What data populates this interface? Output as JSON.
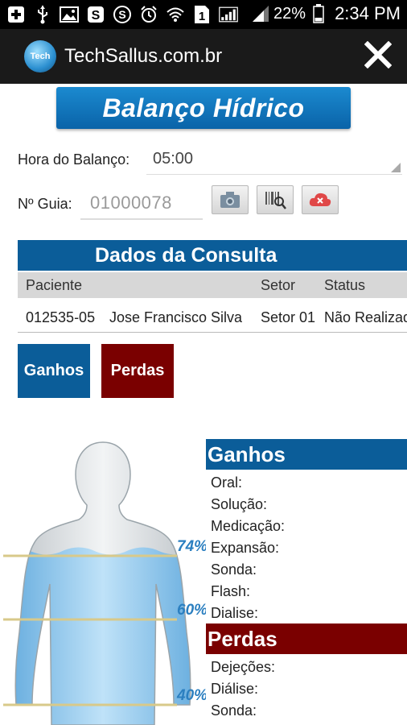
{
  "statusbar": {
    "battery_text": "22%",
    "time": "2:34 PM",
    "left_icons": [
      "add-icon",
      "usb-icon",
      "image-icon",
      "app-s-icon",
      "skype-icon",
      "alarm-icon",
      "wifi-icon",
      "sim-1-icon",
      "signal-icon"
    ]
  },
  "actionbar": {
    "logo_text": "Tech",
    "title": "TechSallus.com.br"
  },
  "banner": {
    "title": "Balanço Hídrico"
  },
  "form": {
    "hora_label": "Hora do Balanço:",
    "hora_value": "05:00",
    "guia_label": "Nº Guia:",
    "guia_value": "01000078"
  },
  "consulta": {
    "title": "Dados da Consulta",
    "columns": [
      "Paciente",
      "Setor",
      "Status"
    ],
    "row": {
      "paciente": "012535-05",
      "nome": "Jose Francisco Silva",
      "setor": "Setor 01",
      "status": "Não Realizado"
    }
  },
  "buttons": {
    "ganhos": "Ganhos",
    "perdas": "Perdas"
  },
  "figure": {
    "levels": [
      "74%",
      "60%",
      "40%"
    ]
  },
  "ganhos_panel": {
    "title": "Ganhos",
    "items": [
      "Oral:",
      "Solução:",
      "Medicação:",
      "Expansão:",
      "Sonda:",
      "Flash:",
      "Dialise:"
    ]
  },
  "perdas_panel": {
    "title": "Perdas",
    "items": [
      "Dejeções:",
      "Diálise:",
      "Sonda:"
    ]
  },
  "colors": {
    "primary_blue": "#0b5d99",
    "dark_red": "#7a0000",
    "banner_blue": "#1b8ad0",
    "water_blue": "#8ec8ee",
    "status_bar": "#000000",
    "action_bar": "#1a1a1a"
  }
}
